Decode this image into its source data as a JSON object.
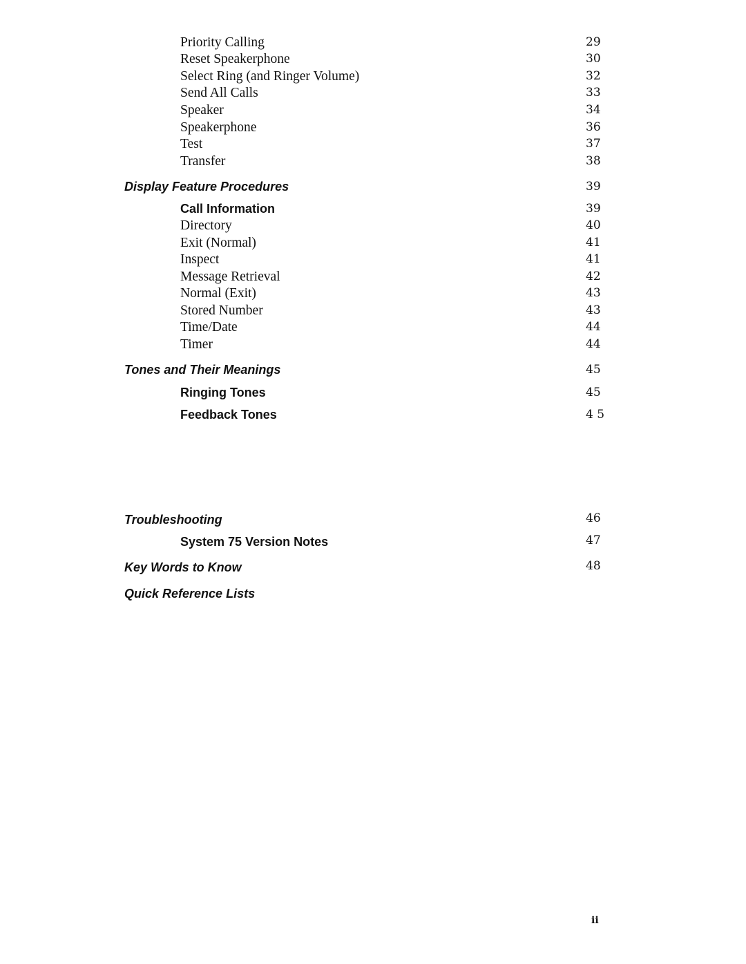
{
  "toc": [
    {
      "label": "Priority  Calling",
      "page": "29",
      "style": "serif"
    },
    {
      "label": "Reset  Speakerphone",
      "page": "30",
      "style": "serif"
    },
    {
      "label": "Select Ring (and Ringer Volume)",
      "page": "32",
      "style": "serif"
    },
    {
      "label": "Send All Calls",
      "page": "33",
      "style": "serif"
    },
    {
      "label": "Speaker",
      "page": "34",
      "style": "serif"
    },
    {
      "label": "Speakerphone",
      "page": "36",
      "style": "serif"
    },
    {
      "label": "Test",
      "page": "37",
      "style": "serif"
    },
    {
      "label": "Transfer",
      "page": "38",
      "style": "serif"
    },
    {
      "label": "Display  Feature  Procedures",
      "page": "39",
      "style": "section"
    },
    {
      "label": "Call  Information",
      "page": "39",
      "style": "subhead"
    },
    {
      "label": "Directory",
      "page": "40",
      "style": "serif"
    },
    {
      "label": "Exit  (Normal)",
      "page": "41",
      "style": "serif"
    },
    {
      "label": "Inspect",
      "page": "41",
      "style": "serif"
    },
    {
      "label": "Message  Retrieval",
      "page": "42",
      "style": "serif"
    },
    {
      "label": "Normal  (Exit)",
      "page": "43",
      "style": "serif"
    },
    {
      "label": "Stored Number",
      "page": "43",
      "style": "serif"
    },
    {
      "label": "Time/Date",
      "page": "44",
      "style": "serif"
    },
    {
      "label": "Timer",
      "page": "44",
      "style": "serif"
    },
    {
      "label": "Tones and Their Meanings",
      "page": "45",
      "style": "section"
    },
    {
      "label": "Ringing  Tones",
      "page": "45",
      "style": "subhead"
    },
    {
      "label": "Feedback  Tones",
      "page": "4 5",
      "style": "subhead"
    },
    {
      "label": "Troubleshooting",
      "page": "46",
      "style": "section"
    },
    {
      "label": "System 75 Version Notes",
      "page": "47",
      "style": "subhead"
    },
    {
      "label": "Key Words to Know",
      "page": "48",
      "style": "section"
    },
    {
      "label": "Quick Reference Lists",
      "page": "",
      "style": "section"
    }
  ],
  "folio": "ii"
}
